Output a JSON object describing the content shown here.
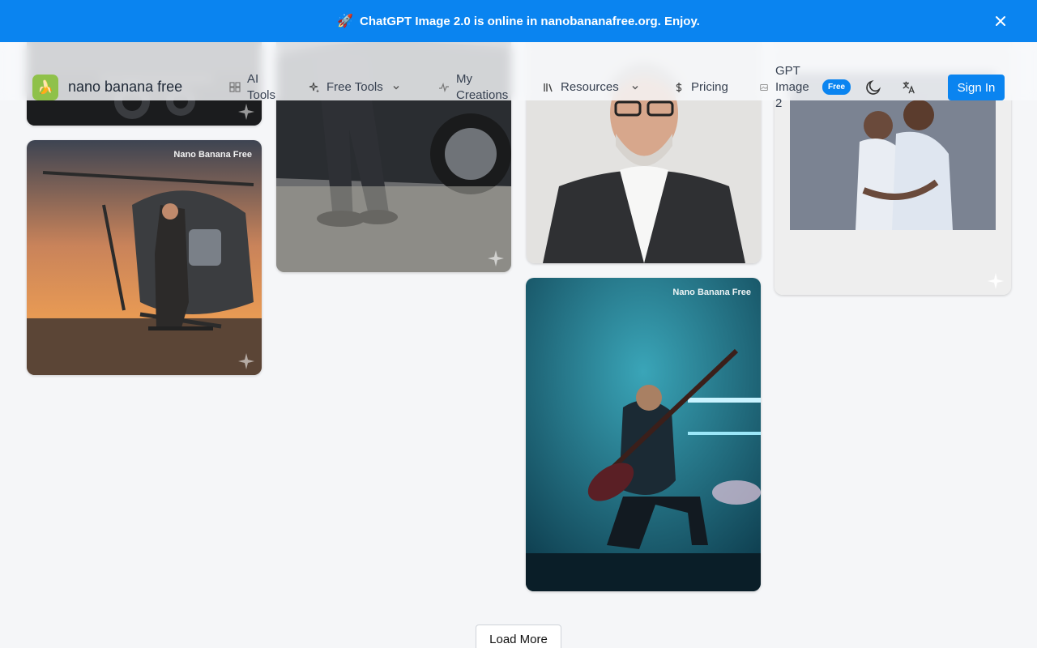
{
  "announcement": {
    "text": "ChatGPT Image 2.0 is online in nanobananafree.org. Enjoy.",
    "rocket": "🚀"
  },
  "brand": {
    "name": "nano banana free",
    "logo_glyph": "🍌"
  },
  "nav": {
    "ai_tools": [
      "AI",
      "Tools"
    ],
    "free_tools": "Free Tools",
    "my_creations": [
      "My",
      "Creations"
    ],
    "resources": "Resources",
    "pricing": "Pricing",
    "gpt_image": [
      "GPT",
      "Image",
      "2"
    ],
    "free_badge": "Free"
  },
  "actions": {
    "sign_in": "Sign In",
    "load_more": "Load More"
  },
  "gallery": {
    "watermark": "Nano Banana Free"
  },
  "colors": {
    "accent": "#0a84f0",
    "logo_bg": "#8fc14a",
    "background": "#f5f6f8"
  },
  "icons": [
    "close-icon",
    "grid-icon",
    "sparkles-icon",
    "activity-icon",
    "library-icon",
    "dollar-icon",
    "image-icon",
    "moon-icon",
    "translate-icon",
    "chevron-down-icon",
    "sparkle-icon"
  ]
}
